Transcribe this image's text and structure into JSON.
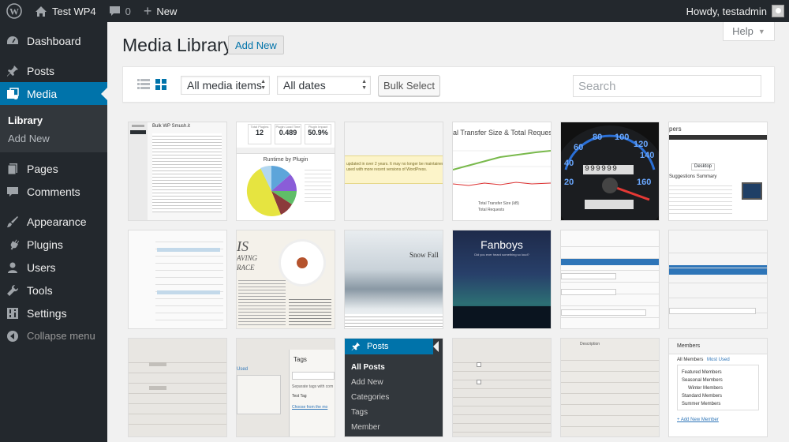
{
  "adminbar": {
    "site_name": "Test WP4",
    "comments_count": "0",
    "new_label": "New",
    "greeting": "Howdy, testadmin"
  },
  "sidebar": {
    "items": [
      {
        "label": "Dashboard",
        "icon": "dashboard-icon"
      },
      {
        "label": "Posts",
        "icon": "pin-icon"
      },
      {
        "label": "Media",
        "icon": "media-icon"
      },
      {
        "label": "Pages",
        "icon": "page-icon"
      },
      {
        "label": "Comments",
        "icon": "comment-icon"
      },
      {
        "label": "Appearance",
        "icon": "brush-icon"
      },
      {
        "label": "Plugins",
        "icon": "plug-icon"
      },
      {
        "label": "Users",
        "icon": "user-icon"
      },
      {
        "label": "Tools",
        "icon": "wrench-icon"
      },
      {
        "label": "Settings",
        "icon": "settings-icon"
      }
    ],
    "media_submenu": [
      "Library",
      "Add New"
    ],
    "collapse_label": "Collapse menu"
  },
  "page": {
    "title": "Media Library",
    "add_new": "Add New",
    "help": "Help"
  },
  "toolbar": {
    "filter_type": "All media items",
    "filter_date": "All dates",
    "bulk_select": "Bulk Select",
    "search_placeholder": "Search"
  },
  "thumbnails": {
    "t1_title": "Bulk WP Smush.it",
    "t2_stats": [
      "12",
      "0.489",
      "50.9%"
    ],
    "t2_labels": [
      "Total Plugins",
      "Plugin Load Time",
      "Plugin Impact"
    ],
    "t2_chart_title": "Runtime by Plugin",
    "t5_title": "al Transfer Size & Total Requests",
    "t5_legend": [
      "Total Transfer Size (kB)",
      "Total Requests"
    ],
    "t6_gauge": [
      "60",
      "80",
      "100",
      "120",
      "140",
      "40",
      "20",
      "160"
    ],
    "t6_odometer": "999999",
    "t7_brand": "pers",
    "t7_tab": "Desktop",
    "t7_heading": "Suggestions Summary",
    "t10_title": "Snow Fall",
    "t11_title": "Fanboys",
    "t11_subtitle": "Did you ever heard something so loud?",
    "t15_label": "Used",
    "t15_tags": "Tags",
    "t15_hint": "Separate tags with com",
    "t15_radio": "Test Tag",
    "t15_link": "Choose from the mo",
    "t16_menu": [
      "Posts",
      "All Posts",
      "Add New",
      "Categories",
      "Tags",
      "Member"
    ],
    "t18_col": "Description",
    "t19_title": "Members",
    "t19_tabs": [
      "All Members",
      "Most Used"
    ],
    "t19_items": [
      "Featured Members",
      "Seasonal Members",
      "Winter Members",
      "Standard Members",
      "Summer Members"
    ],
    "t19_add": "+ Add New Member",
    "t9_text": "updated in over 2 years. It may no longer be maintained or suppor",
    "t9_text2": "used with more recent versions of WordPress."
  },
  "colors": {
    "admin_bar": "#23282d",
    "accent": "#0073aa",
    "background": "#f1f1f1",
    "sidebar": "#23282d"
  }
}
